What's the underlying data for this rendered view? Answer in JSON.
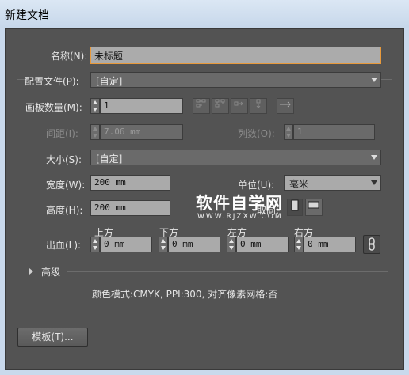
{
  "window": {
    "title": "新建文档"
  },
  "form": {
    "name_label": "名称(N):",
    "name_value": "未标题",
    "profile_label": "配置文件(P):",
    "profile_value": "[自定]",
    "artboards_label": "画板数量(M):",
    "artboards_value": "1",
    "spacing_label": "间距(I):",
    "spacing_value": "7.06 mm",
    "columns_label": "列数(O):",
    "columns_value": "1",
    "size_label": "大小(S):",
    "size_value": "[自定]",
    "width_label": "宽度(W):",
    "width_value": "200 mm",
    "units_label": "单位(U):",
    "units_value": "毫米",
    "height_label": "高度(H):",
    "height_value": "200 mm",
    "orientation_label": "取向:",
    "bleed_label": "出血(L):",
    "bleed_top_label": "上方",
    "bleed_bottom_label": "下方",
    "bleed_left_label": "左方",
    "bleed_right_label": "右方",
    "bleed_top_value": "0 mm",
    "bleed_bottom_value": "0 mm",
    "bleed_left_value": "0 mm",
    "bleed_right_value": "0 mm",
    "advanced_label": "高级",
    "summary": "颜色模式:CMYK, PPI:300, 对齐像素网格:否",
    "templates_button": "模板(T)..."
  },
  "watermark": {
    "brand": "软件自学网",
    "url": "WWW.RJZXW.COM"
  },
  "icons": {
    "arrange_grid_by_row": "grid-by-row-icon",
    "arrange_grid_by_column": "grid-by-column-icon",
    "arrange_by_row": "arrange-row-icon",
    "arrange_by_column": "arrange-column-icon",
    "layout_direction": "arrow-right-icon",
    "orientation_portrait": "portrait-icon",
    "orientation_landscape": "landscape-icon",
    "link_bleed": "chain-link-icon",
    "advanced_toggle": "triangle-right-icon"
  },
  "colors": {
    "dialog_bg": "#535353",
    "name_focus": "#e89a3c",
    "titlebar": "#c9d9ec"
  }
}
